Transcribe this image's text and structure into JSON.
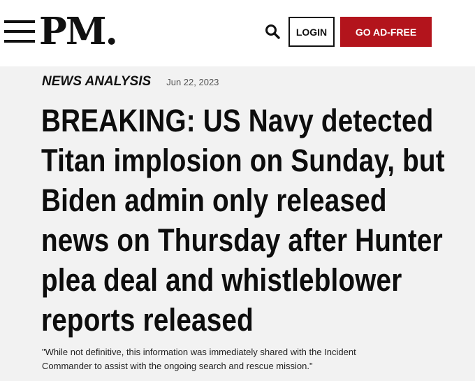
{
  "header": {
    "logo_text": "PM.",
    "search_icon": "search-icon",
    "menu_icon": "hamburger-menu-icon",
    "login_label": "LOGIN",
    "adfree_label": "GO AD-FREE",
    "accent_color": "#b3141c"
  },
  "article": {
    "category": "NEWS ANALYSIS",
    "date": "Jun 22, 2023",
    "headline_lines": [
      "BREAKING: US Navy detected",
      "Titan implosion on Sunday, but",
      "Biden admin only released",
      "news on Thursday after Hunter",
      "plea deal and whistleblower",
      "reports released"
    ],
    "subhead_lines": [
      "\"While not definitive, this information was immediately shared with the Incident",
      "Commander to assist with the ongoing search and rescue mission.\""
    ]
  }
}
